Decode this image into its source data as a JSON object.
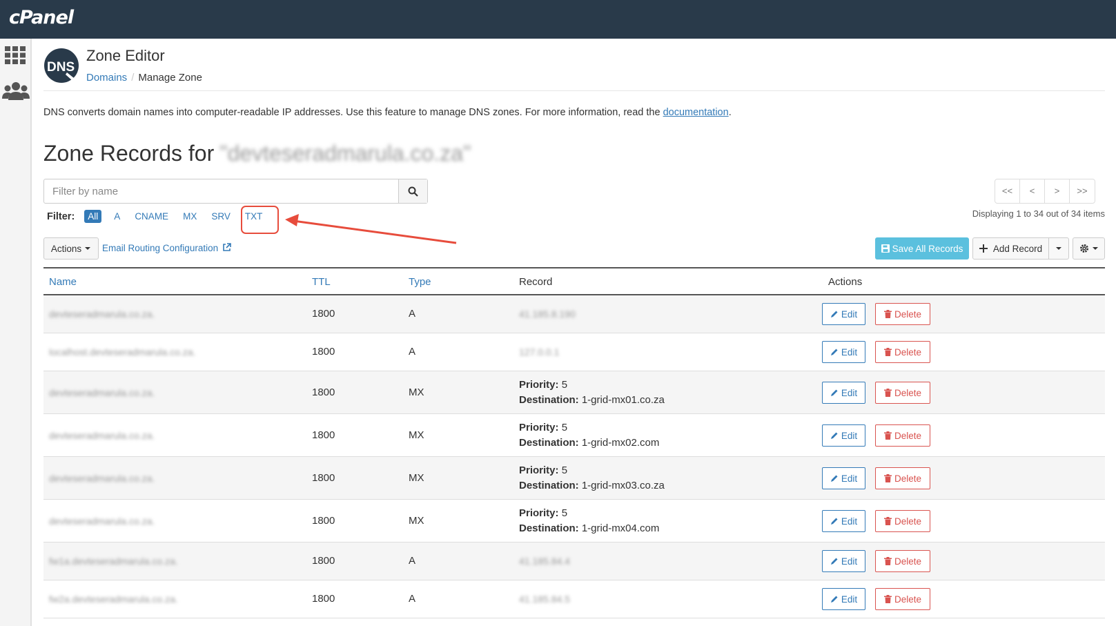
{
  "brand": "cPanel",
  "header": {
    "title": "Zone Editor",
    "breadcrumb": {
      "parent": "Domains",
      "separator": "/",
      "current": "Manage Zone"
    }
  },
  "description": {
    "text": "DNS converts domain names into computer-readable IP addresses. Use this feature to manage DNS zones. For more information, read the ",
    "link": "documentation",
    "end": "."
  },
  "zone": {
    "title_prefix": "Zone Records for",
    "domain": "\"devteseradmarula.co.za\""
  },
  "search": {
    "placeholder": "Filter by name"
  },
  "filter": {
    "label": "Filter:",
    "options": [
      "All",
      "A",
      "CNAME",
      "MX",
      "SRV",
      "TXT"
    ],
    "active": "All",
    "highlighted": "TXT"
  },
  "pagination": {
    "first": "<<",
    "prev": "<",
    "next": ">",
    "last": ">>",
    "status": "Displaying 1 to 34 out of 34 items"
  },
  "toolbar": {
    "actions_label": "Actions",
    "email_routing": "Email Routing Configuration",
    "save_all": "Save All Records",
    "add_record": "Add Record"
  },
  "table": {
    "columns": [
      "Name",
      "TTL",
      "Type",
      "Record",
      "Actions"
    ],
    "edit_label": "Edit",
    "delete_label": "Delete",
    "rows": [
      {
        "name": "devteseradmarula.co.za.",
        "ttl": "1800",
        "type": "A",
        "record": "41.185.8.190"
      },
      {
        "name": "localhost.devteseradmarula.co.za.",
        "ttl": "1800",
        "type": "A",
        "record": "127.0.0.1"
      },
      {
        "name": "devteseradmarula.co.za.",
        "ttl": "1800",
        "type": "MX",
        "priority_label": "Priority:",
        "priority": "5",
        "dest_label": "Destination:",
        "destination": "1-grid-mx01.co.za"
      },
      {
        "name": "devteseradmarula.co.za.",
        "ttl": "1800",
        "type": "MX",
        "priority_label": "Priority:",
        "priority": "5",
        "dest_label": "Destination:",
        "destination": "1-grid-mx02.com"
      },
      {
        "name": "devteseradmarula.co.za.",
        "ttl": "1800",
        "type": "MX",
        "priority_label": "Priority:",
        "priority": "5",
        "dest_label": "Destination:",
        "destination": "1-grid-mx03.co.za"
      },
      {
        "name": "devteseradmarula.co.za.",
        "ttl": "1800",
        "type": "MX",
        "priority_label": "Priority:",
        "priority": "5",
        "dest_label": "Destination:",
        "destination": "1-grid-mx04.com"
      },
      {
        "name": "fw1a.devteseradmarula.co.za.",
        "ttl": "1800",
        "type": "A",
        "record": "41.185.84.4"
      },
      {
        "name": "fw2a.devteseradmarula.co.za.",
        "ttl": "1800",
        "type": "A",
        "record": "41.185.84.5"
      }
    ]
  },
  "colors": {
    "topbar": "#293a4a",
    "link": "#337ab7",
    "danger": "#d9534f",
    "info": "#5bc0de",
    "highlight": "#e74c3c"
  }
}
